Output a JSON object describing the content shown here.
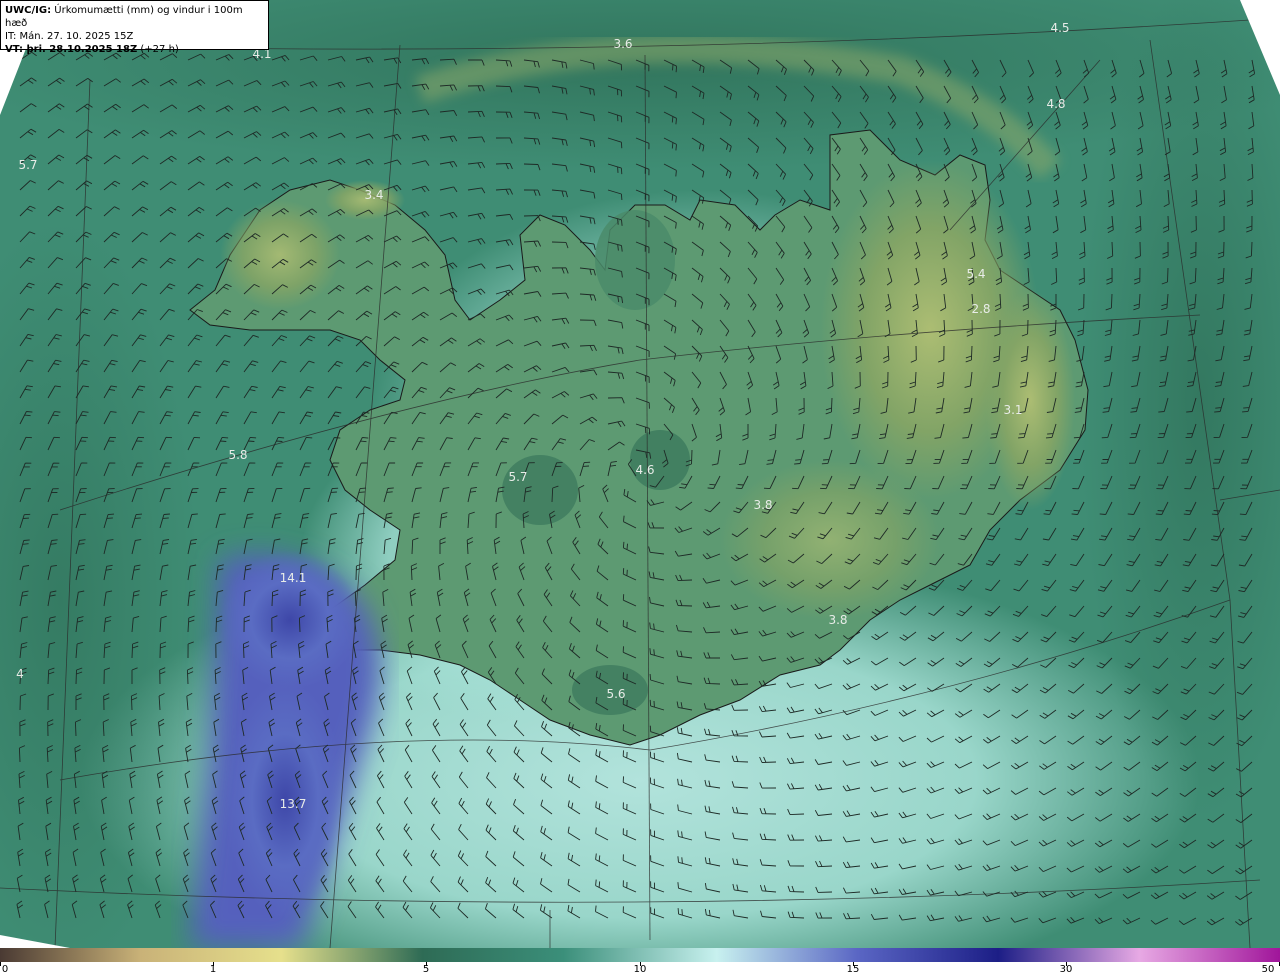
{
  "header": {
    "title_bold": "UWC/IG:",
    "title_rest": " Úrkomumætti (mm) og vindur i 100m hæð",
    "it_line": "IT: Mán. 27. 10. 2025 15Z",
    "vt_bold": "VT: þri. 28.10.2025 18Z",
    "vt_rest": " (+27 h)"
  },
  "value_labels": [
    "4.1",
    "3.6",
    "4.5",
    "4.8",
    "5.7",
    "3.4",
    "5.4",
    "2.8",
    "3.1",
    "5.8",
    "4.6",
    "5.7",
    "3.8",
    "14.1",
    "3.8",
    "5.6",
    "4",
    "13.7"
  ],
  "colorbar": {
    "ticks": [
      "0",
      "1",
      "5",
      "10",
      "15",
      "30",
      "50"
    ],
    "colors": [
      "#4a3a33",
      "#c9b278",
      "#e6e08c",
      "#2e6b55",
      "#3b8f7a",
      "#c8f1ef",
      "#5a66c4",
      "#1c1e86",
      "#e7a9e4",
      "#a0159a"
    ]
  },
  "colors": {
    "land_dark": "#3f7d5f",
    "land_light": "#a8b86a",
    "ocean": "#3e8f76",
    "ocean_light": "#b7ece6",
    "high_precip": "#4a56b2"
  }
}
